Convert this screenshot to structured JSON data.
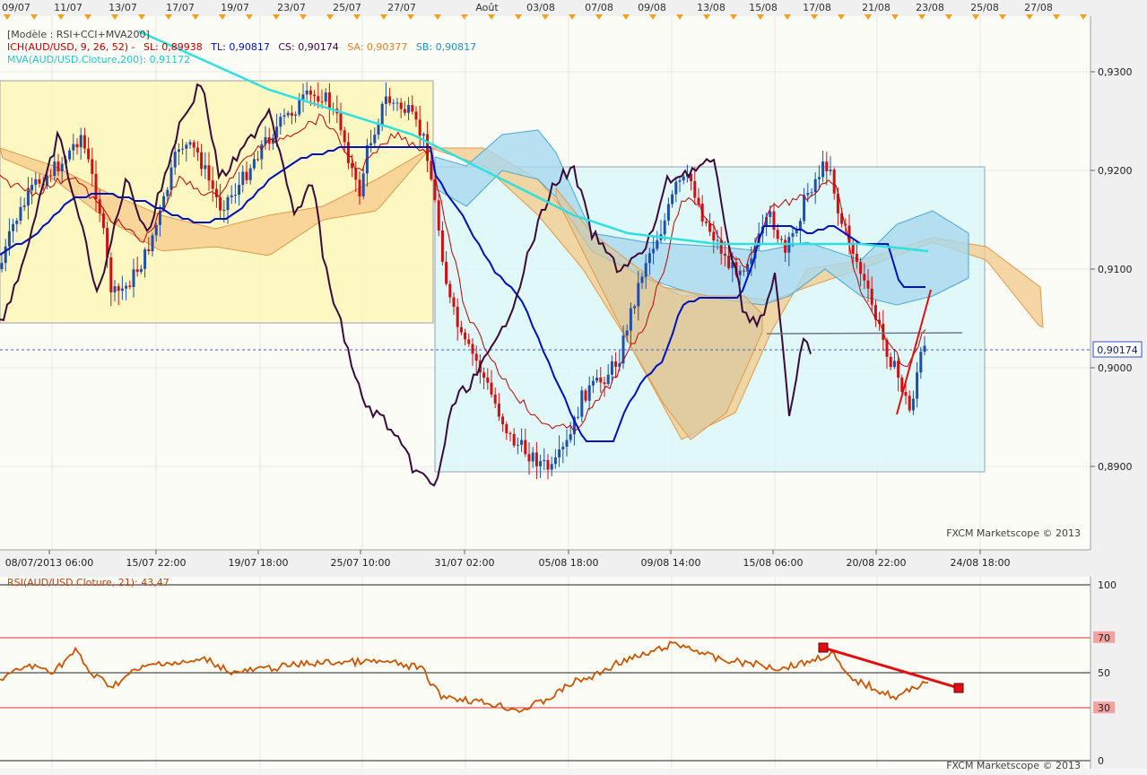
{
  "top_dates": [
    "09/07",
    "11/07",
    "13/07",
    "17/07",
    "19/07",
    "23/07",
    "25/07",
    "27/07",
    "Août",
    "03/08",
    "07/08",
    "09/08",
    "13/08",
    "15/08",
    "17/08",
    "21/08",
    "23/08",
    "25/08",
    "27/08"
  ],
  "legend": {
    "model": "[Modèle : RSI+CCI+MVA200]",
    "ich": "ICH(AUD/USD, 9, 26, 52) -",
    "sl": "SL: 0,89938",
    "tl": "TL: 0,90817",
    "cs": "CS: 0,90174",
    "sa": "SA: 0,90377",
    "sb": "SB: 0,90817",
    "mva": "MVA(AUD/USD.Cloture,200): 0,91172"
  },
  "price_axis": {
    "ticks": [
      "0,9300",
      "0,9200",
      "0,9100",
      "0,9000",
      "0,8900"
    ],
    "current_label": "0,90174"
  },
  "bottom_dates": [
    "08/07/2013 06:00",
    "15/07 22:00",
    "19/07 18:00",
    "25/07 10:00",
    "31/07 02:00",
    "05/08 18:00",
    "09/08 14:00",
    "15/08 06:00",
    "20/08 22:00",
    "24/08 18:00"
  ],
  "watermark": "FXCM Marketscope © 2013",
  "rsi": {
    "label": "RSI(AUD/USD.Cloture, 21): 43,47",
    "ticks": [
      "100",
      "70",
      "50",
      "30",
      "0"
    ]
  },
  "colors": {
    "bull": "#1f4fa8",
    "bear": "#d01010",
    "mva": "#2ee0e0",
    "tenkan": "#c00000",
    "kijun": "#0010c0",
    "chikou": "#3a0a3a",
    "rsi": "#cc5500"
  },
  "chart_data": {
    "type": "line",
    "instrument": "AUD/USD",
    "current_price": 0.90174,
    "y_axis": {
      "min": 0.885,
      "max": 0.935
    },
    "rsi_axis": {
      "min": 0,
      "max": 100
    },
    "mva200": [
      {
        "x": "08/07/2013",
        "y": 0.9338
      },
      {
        "x": "15/07/2013",
        "y": 0.931
      },
      {
        "x": "22/07/2013",
        "y": 0.927
      },
      {
        "x": "29/07/2013",
        "y": 0.9215
      },
      {
        "x": "05/08/2013",
        "y": 0.9165
      },
      {
        "x": "12/08/2013",
        "y": 0.9132
      },
      {
        "x": "19/08/2013",
        "y": 0.912
      },
      {
        "x": "22/08/2013",
        "y": 0.9117
      }
    ],
    "rsi_values": [
      {
        "x": "08/07/2013",
        "y": 48
      },
      {
        "x": "15/07/2013",
        "y": 52
      },
      {
        "x": "22/07/2013",
        "y": 52
      },
      {
        "x": "29/07/2013",
        "y": 42
      },
      {
        "x": "05/08/2013",
        "y": 31
      },
      {
        "x": "12/08/2013",
        "y": 56
      },
      {
        "x": "19/08/2013",
        "y": 58
      },
      {
        "x": "22/08/2013",
        "y": 43.47
      }
    ]
  }
}
